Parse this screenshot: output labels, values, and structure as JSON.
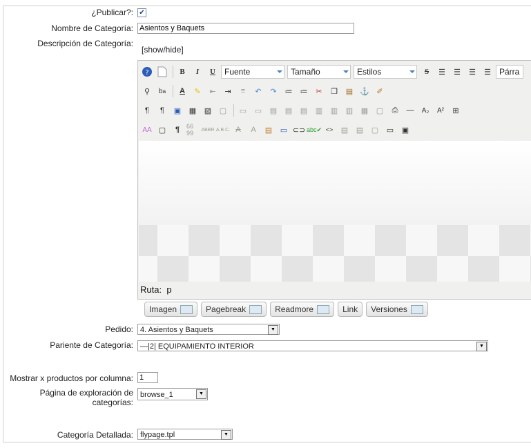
{
  "form": {
    "publish_label": "¿Publicar?:",
    "publish_checked": true,
    "name_label": "Nombre de Categoría:",
    "name_value": "Asientos y Baquets",
    "desc_label": "Descripción de Categoría:",
    "show_hide": "[show/hide]",
    "order_label": "Pedido:",
    "order_value": "4. Asientos y Baquets",
    "parent_label": "Pariente de Categoría:",
    "parent_value": "—|2| EQUIPAMIENTO INTERIOR",
    "products_label": "Mostrar x productos por columna:",
    "products_value": "1",
    "browse_label_1": "Página de exploración de",
    "browse_label_2": "categorías:",
    "browse_value": "browse_1",
    "detail_label": "Categoría Detallada:",
    "detail_value": "flypage.tpl"
  },
  "editor": {
    "font_select": "Fuente",
    "size_select": "Tamaño",
    "styles_select": "Estilos",
    "format_select": "Párra",
    "path_label": "Ruta:",
    "path_value": "p"
  },
  "extra_buttons": {
    "image": "Imagen",
    "pagebreak": "Pagebreak",
    "readmore": "Readmore",
    "link": "Link",
    "versions": "Versiones"
  },
  "colors": {
    "accent": "#4a7fc6",
    "border": "#c0c0c0"
  }
}
